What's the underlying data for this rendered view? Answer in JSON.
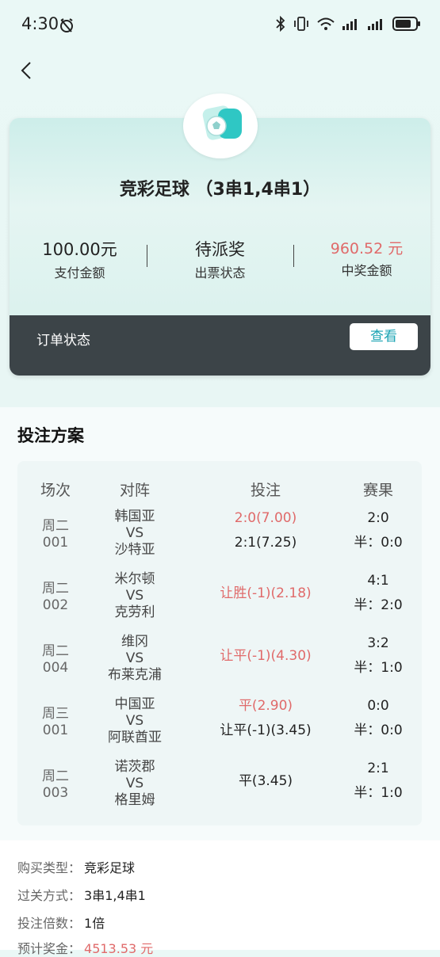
{
  "status_bar": {
    "time": "4:30"
  },
  "header": {
    "back_icon": "chevron-left-icon"
  },
  "summary": {
    "title": "竞彩足球 （3串1,4串1）",
    "stats": [
      {
        "value": "100.00元",
        "label": "支付金额"
      },
      {
        "value": "待派奖",
        "label": "出票状态"
      },
      {
        "value": "960.52 元",
        "label": "中奖金额"
      }
    ],
    "order_status_label": "订单状态",
    "view_button": "查看"
  },
  "plan": {
    "title": "投注方案",
    "headers": [
      "场次",
      "对阵",
      "投注",
      "赛果"
    ],
    "rows": [
      {
        "day": "周二",
        "num": "001",
        "home": "韩国亚",
        "vs": "VS",
        "away": "沙特亚",
        "bets": [
          {
            "text": "2:0(7.00)",
            "hit": true
          },
          {
            "text": "2:1(7.25)",
            "hit": false
          }
        ],
        "result": "2:0",
        "half": "半：0:0"
      },
      {
        "day": "周二",
        "num": "002",
        "home": "米尔顿",
        "vs": "VS",
        "away": "克劳利",
        "bets": [
          {
            "text": "让胜(-1)(2.18)",
            "hit": true
          }
        ],
        "result": "4:1",
        "half": "半：2:0"
      },
      {
        "day": "周二",
        "num": "004",
        "home": "维冈",
        "vs": "VS",
        "away": "布莱克浦",
        "bets": [
          {
            "text": "让平(-1)(4.30)",
            "hit": true
          }
        ],
        "result": "3:2",
        "half": "半：1:0"
      },
      {
        "day": "周三",
        "num": "001",
        "home": "中国亚",
        "vs": "VS",
        "away": "阿联酋亚",
        "bets": [
          {
            "text": "平(2.90)",
            "hit": true
          },
          {
            "text": "让平(-1)(3.45)",
            "hit": false
          }
        ],
        "result": "0:0",
        "half": "半：0:0"
      },
      {
        "day": "周二",
        "num": "003",
        "home": "诺茨郡",
        "vs": "VS",
        "away": "格里姆",
        "bets": [
          {
            "text": "平(3.45)",
            "hit": false
          }
        ],
        "result": "2:1",
        "half": "半：1:0"
      }
    ]
  },
  "details": [
    {
      "label": "购买类型：",
      "value": "竞彩足球"
    },
    {
      "label": "过关方式：",
      "value": "3串1,4串1"
    },
    {
      "label": "投注倍数：",
      "value": "1倍"
    },
    {
      "label": "预计奖金：",
      "value": "4513.53 元"
    }
  ],
  "colors": {
    "accent": "#1aa3b3",
    "win_red": "#e06a6a",
    "order_bar": "#3c4448"
  }
}
